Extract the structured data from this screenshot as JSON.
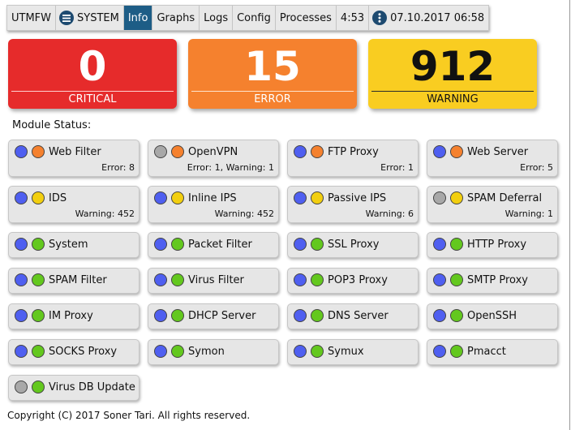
{
  "menu": {
    "brand": "UTMFW",
    "system_label": "SYSTEM",
    "items": [
      "Info",
      "Graphs",
      "Logs",
      "Config",
      "Processes"
    ],
    "active": "Info",
    "uptime": "4:53",
    "datetime": "07.10.2017 06:58"
  },
  "summary": {
    "critical": {
      "count": "0",
      "label": "CRITICAL",
      "color": "#e62b2b"
    },
    "error": {
      "count": "15",
      "label": "ERROR",
      "color": "#f5812e"
    },
    "warning": {
      "count": "912",
      "label": "WARNING",
      "color": "#f9cd21"
    }
  },
  "module_status_title": "Module Status:",
  "status_colors": {
    "blue": "#4f5ff0",
    "gray": "#a8a8a8",
    "orange": "#f5812e",
    "yellow": "#f2cf0f",
    "green": "#63c81e"
  },
  "modules": [
    {
      "name": "Web Filter",
      "running": "blue",
      "status": "orange",
      "detail": "Error: 8"
    },
    {
      "name": "OpenVPN",
      "running": "gray",
      "status": "orange",
      "detail": "Error: 1, Warning: 1"
    },
    {
      "name": "FTP Proxy",
      "running": "blue",
      "status": "orange",
      "detail": "Error: 1"
    },
    {
      "name": "Web Server",
      "running": "blue",
      "status": "orange",
      "detail": "Error: 5"
    },
    {
      "name": "IDS",
      "running": "blue",
      "status": "yellow",
      "detail": "Warning: 452"
    },
    {
      "name": "Inline IPS",
      "running": "blue",
      "status": "yellow",
      "detail": "Warning: 452"
    },
    {
      "name": "Passive IPS",
      "running": "blue",
      "status": "yellow",
      "detail": "Warning: 6"
    },
    {
      "name": "SPAM Deferral",
      "running": "gray",
      "status": "yellow",
      "detail": "Warning: 1"
    },
    {
      "name": "System",
      "running": "blue",
      "status": "green",
      "detail": ""
    },
    {
      "name": "Packet Filter",
      "running": "blue",
      "status": "green",
      "detail": ""
    },
    {
      "name": "SSL Proxy",
      "running": "blue",
      "status": "green",
      "detail": ""
    },
    {
      "name": "HTTP Proxy",
      "running": "blue",
      "status": "green",
      "detail": ""
    },
    {
      "name": "SPAM Filter",
      "running": "blue",
      "status": "green",
      "detail": ""
    },
    {
      "name": "Virus Filter",
      "running": "blue",
      "status": "green",
      "detail": ""
    },
    {
      "name": "POP3 Proxy",
      "running": "blue",
      "status": "green",
      "detail": ""
    },
    {
      "name": "SMTP Proxy",
      "running": "blue",
      "status": "green",
      "detail": ""
    },
    {
      "name": "IM Proxy",
      "running": "blue",
      "status": "green",
      "detail": ""
    },
    {
      "name": "DHCP Server",
      "running": "blue",
      "status": "green",
      "detail": ""
    },
    {
      "name": "DNS Server",
      "running": "blue",
      "status": "green",
      "detail": ""
    },
    {
      "name": "OpenSSH",
      "running": "blue",
      "status": "green",
      "detail": ""
    },
    {
      "name": "SOCKS Proxy",
      "running": "blue",
      "status": "green",
      "detail": ""
    },
    {
      "name": "Symon",
      "running": "blue",
      "status": "green",
      "detail": ""
    },
    {
      "name": "Symux",
      "running": "blue",
      "status": "green",
      "detail": ""
    },
    {
      "name": "Pmacct",
      "running": "blue",
      "status": "green",
      "detail": ""
    },
    {
      "name": "Virus DB Update",
      "running": "gray",
      "status": "green",
      "detail": ""
    }
  ],
  "footer": "Copyright (C) 2017 Soner Tari. All rights reserved."
}
